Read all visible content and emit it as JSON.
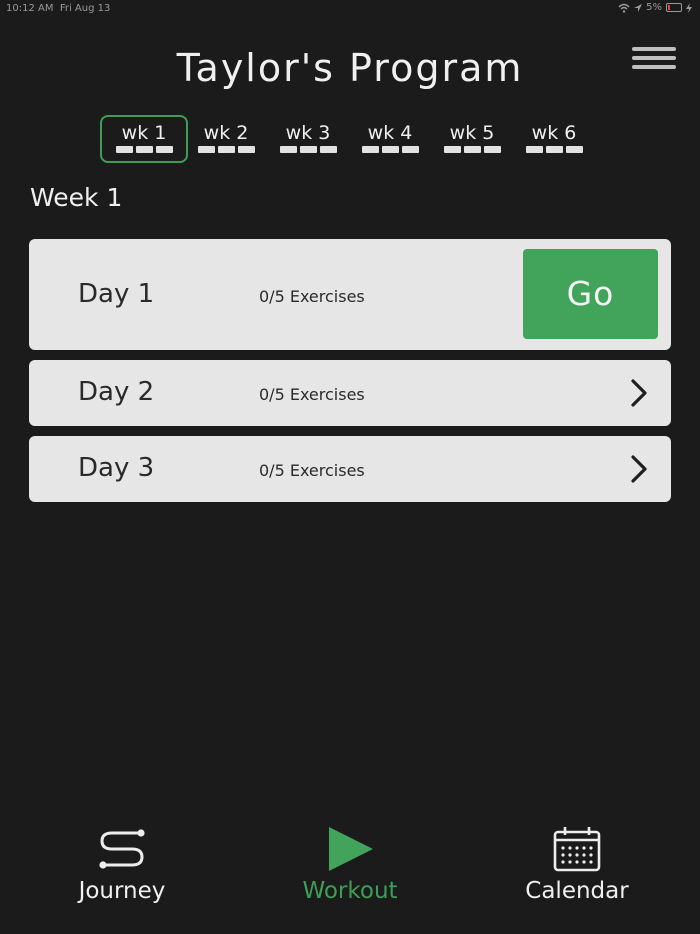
{
  "status_bar": {
    "time": "10:12 AM",
    "date": "Fri Aug 13",
    "battery_text": "5%"
  },
  "header": {
    "title": "Taylor's Program"
  },
  "weeks": [
    {
      "label": "wk 1"
    },
    {
      "label": "wk 2"
    },
    {
      "label": "wk 3"
    },
    {
      "label": "wk 4"
    },
    {
      "label": "wk 5"
    },
    {
      "label": "wk 6"
    }
  ],
  "selected_week": "wk 1",
  "week_heading": "Week 1",
  "days": [
    {
      "name": "Day 1",
      "count": "0/5 Exercises",
      "action": "Go"
    },
    {
      "name": "Day 2",
      "count": "0/5 Exercises"
    },
    {
      "name": "Day 3",
      "count": "0/5 Exercises"
    }
  ],
  "tabs": [
    {
      "label": "Journey",
      "icon": "journey-icon"
    },
    {
      "label": "Workout",
      "icon": "play-icon"
    },
    {
      "label": "Calendar",
      "icon": "calendar-icon"
    }
  ],
  "active_tab": "Workout",
  "colors": {
    "background": "#1b1b1b",
    "accent": "#42a35a",
    "card": "#e6e6e6",
    "text": "#ececec"
  }
}
